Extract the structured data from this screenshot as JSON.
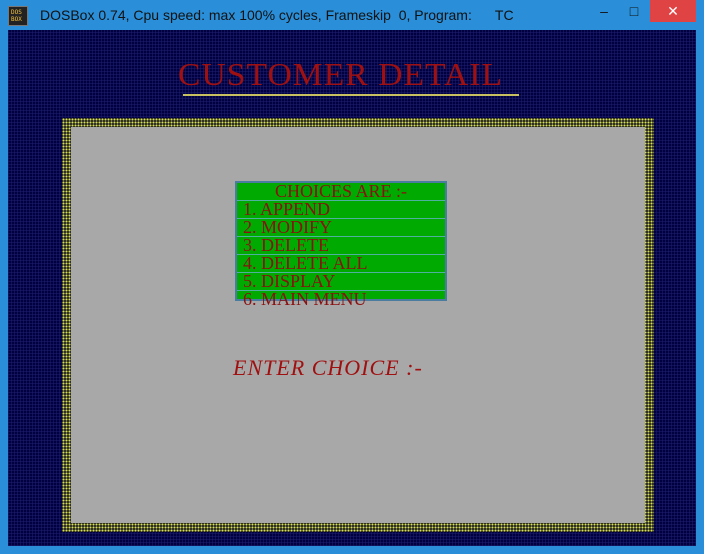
{
  "window": {
    "title": "DOSBox 0.74, Cpu speed: max 100% cycles, Frameskip  0, Program:      TC",
    "icon_top": "DOS",
    "icon_bottom": "BOX",
    "minimize_glyph": "–",
    "maximize_glyph": "□",
    "close_glyph": "✕"
  },
  "screen": {
    "heading": "CUSTOMER DETAIL",
    "menu": {
      "header": "CHOICES ARE :-",
      "items": [
        "1. APPEND",
        "2. MODIFY",
        "3. DELETE",
        "4. DELETE ALL",
        "5. DISPLAY",
        "6. MAIN MENU"
      ]
    },
    "prompt": "ENTER CHOICE :-"
  },
  "colors": {
    "titlebar": "#2a8fd8",
    "background": "#000040",
    "heading": "#a01010",
    "panel": "#a8a8a8",
    "menu_bg": "#00aa00",
    "menu_text": "#8b1010",
    "close_button": "#e04343"
  }
}
